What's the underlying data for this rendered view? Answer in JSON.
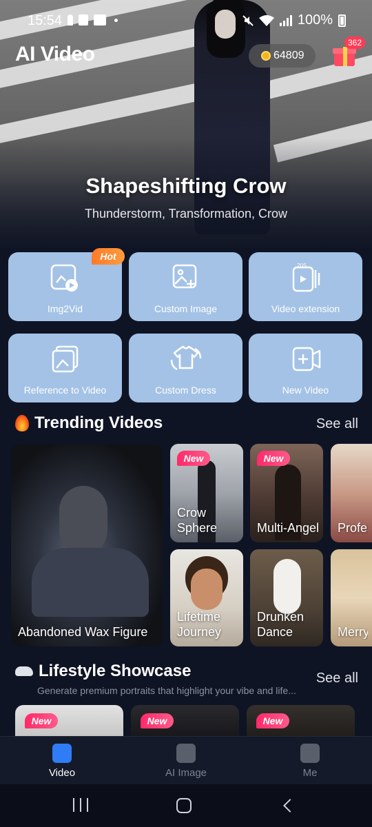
{
  "status_bar": {
    "time": "15:54",
    "battery": "100%"
  },
  "header": {
    "app_title": "AI Video",
    "coins": "64809",
    "gift_badge": "362"
  },
  "hero": {
    "title": "Shapeshifting Crow",
    "subtitle": "Thunderstorm, Transformation, Crow"
  },
  "tools": [
    {
      "label": "Img2Vid",
      "icon": "image-to-video-icon",
      "badge": "Hot"
    },
    {
      "label": "Custom Image",
      "icon": "image-plus-icon"
    },
    {
      "label": "Video extension",
      "icon": "video-extend-20s-icon",
      "icon_text": "20S"
    },
    {
      "label": "Reference to Video",
      "icon": "reference-images-icon"
    },
    {
      "label": "Custom Dress",
      "icon": "shirt-swap-icon"
    },
    {
      "label": "New Video",
      "icon": "add-video-icon"
    }
  ],
  "trending": {
    "title": "Trending Videos",
    "see_all": "See all",
    "items": [
      {
        "caption": "Abandoned Wax Figure"
      },
      {
        "caption": "Crow Sphere",
        "badge": "New"
      },
      {
        "caption": "Multi-Angels Sh...",
        "badge": "New"
      },
      {
        "caption": "Professional Ph"
      },
      {
        "caption": "Lifetime Journey"
      },
      {
        "caption": "Drunken Dance"
      },
      {
        "caption": "Merry Christmas"
      }
    ]
  },
  "lifestyle": {
    "title": "Lifestyle Showcase",
    "subtitle": "Generate premium portraits that highlight your vibe and life...",
    "see_all": "See all",
    "badges": [
      "New",
      "New",
      "New"
    ]
  },
  "bottom_nav": [
    {
      "label": "Video",
      "active": true
    },
    {
      "label": "AI Image",
      "active": false
    },
    {
      "label": "Me",
      "active": false
    }
  ],
  "colors": {
    "background": "#0f1424",
    "tool_tile": "#a4c2e6",
    "accent": "#2f7df6",
    "hot": "#ff8a2a",
    "new": "#ff3a78"
  }
}
